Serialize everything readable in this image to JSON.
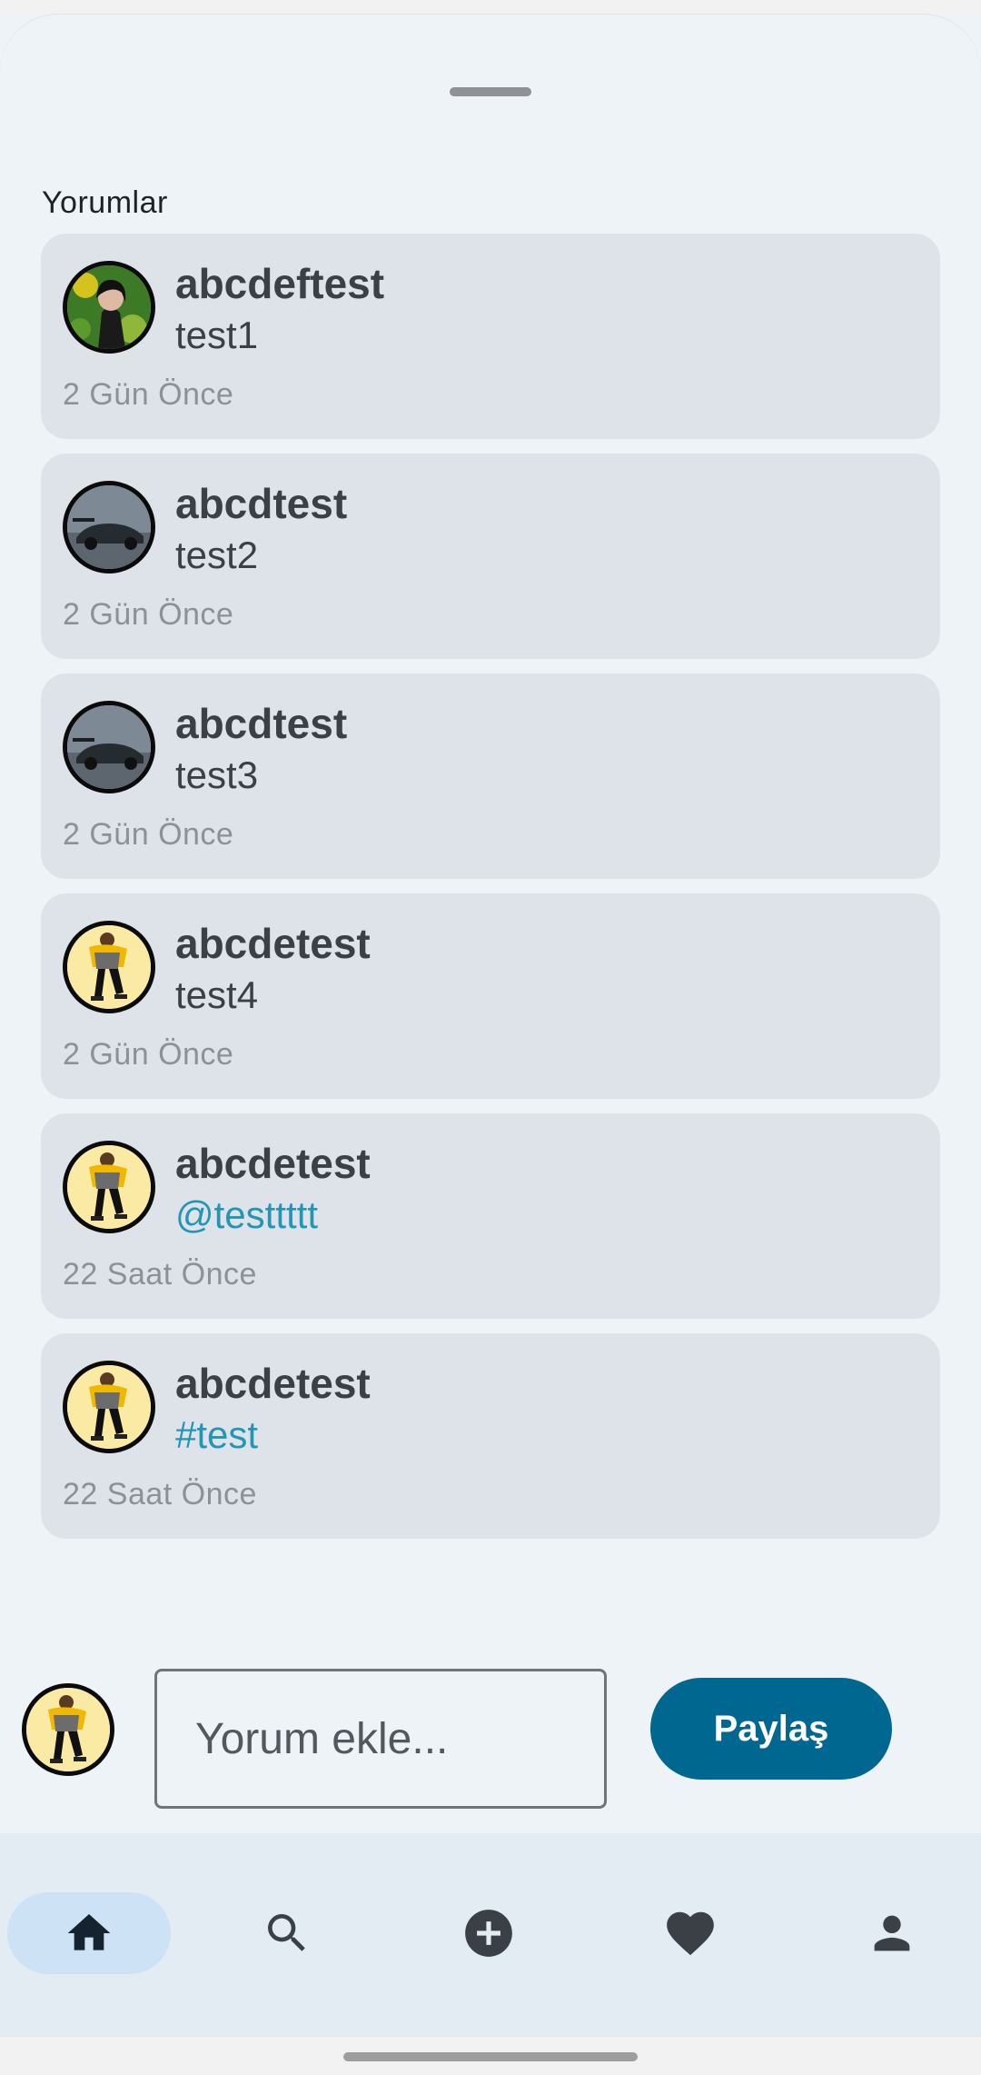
{
  "sheet": {
    "title": "Yorumlar"
  },
  "comments": [
    {
      "username": "abcdeftest",
      "text": "test1",
      "time": "2 Gün Önce",
      "avatar": "avatar-woman-plants",
      "is_link": false
    },
    {
      "username": "abcdtest",
      "text": "test2",
      "time": "2 Gün Önce",
      "avatar": "avatar-car",
      "is_link": false
    },
    {
      "username": "abcdtest",
      "text": "test3",
      "time": "2 Gün Önce",
      "avatar": "avatar-car",
      "is_link": false
    },
    {
      "username": "abcdetest",
      "text": "test4",
      "time": "2 Gün Önce",
      "avatar": "avatar-dancer",
      "is_link": false
    },
    {
      "username": "abcdetest",
      "text": "@testtttt",
      "time": "22 Saat Önce",
      "avatar": "avatar-dancer",
      "is_link": true
    },
    {
      "username": "abcdetest",
      "text": "#test",
      "time": "22 Saat Önce",
      "avatar": "avatar-dancer",
      "is_link": true
    }
  ],
  "composer": {
    "placeholder": "Yorum ekle...",
    "value": "",
    "share_label": "Paylaş",
    "avatar": "avatar-dancer"
  },
  "bottom_nav": {
    "items": [
      {
        "icon": "home-icon",
        "active": true
      },
      {
        "icon": "search-icon",
        "active": false
      },
      {
        "icon": "add-circle-icon",
        "active": false
      },
      {
        "icon": "heart-icon",
        "active": false
      },
      {
        "icon": "person-icon",
        "active": false
      }
    ]
  },
  "colors": {
    "background": "#eef3f7",
    "card": "#dde3e9",
    "text": "#3a4046",
    "link": "#2196b5",
    "primary": "#006890",
    "nav_background": "#e3ebf3",
    "nav_active": "#cde3f5"
  }
}
